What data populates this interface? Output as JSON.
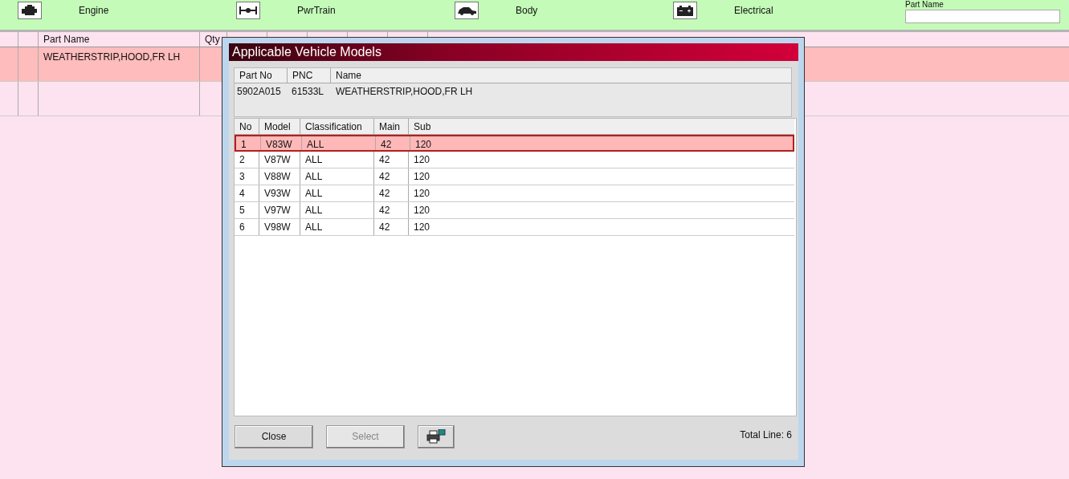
{
  "toolbar": {
    "categories": [
      {
        "kind": "engine",
        "label": "Engine"
      },
      {
        "kind": "drivetrain",
        "label": "PwrTrain"
      },
      {
        "kind": "car",
        "label": "Body"
      },
      {
        "kind": "battery",
        "label": "Electrical"
      }
    ],
    "search": {
      "label": "Part Name"
    }
  },
  "parts_table": {
    "columns": [
      "Part Name",
      "Qty"
    ],
    "rows": [
      {
        "selected": true,
        "part_name": "WEATHERSTRIP,HOOD,FR LH"
      },
      {
        "selected": false
      }
    ]
  },
  "dialog": {
    "title": "Applicable Vehicle Models",
    "part_info": {
      "columns": [
        "Part No",
        "PNC",
        "Name"
      ],
      "values": [
        "5902A015",
        "61533L",
        "WEATHERSTRIP,HOOD,FR LH"
      ]
    },
    "models": {
      "columns": [
        "No",
        "Model",
        "Classification",
        "Main",
        "Sub"
      ],
      "rows": [
        {
          "selected": true,
          "cells": [
            "1",
            "V83W",
            "ALL",
            "42",
            "120"
          ]
        },
        {
          "selected": false,
          "cells": [
            "2",
            "V87W",
            "ALL",
            "42",
            "120"
          ]
        },
        {
          "selected": false,
          "cells": [
            "3",
            "V88W",
            "ALL",
            "42",
            "120"
          ]
        },
        {
          "selected": false,
          "cells": [
            "4",
            "V93W",
            "ALL",
            "42",
            "120"
          ]
        },
        {
          "selected": false,
          "cells": [
            "5",
            "V97W",
            "ALL",
            "42",
            "120"
          ]
        },
        {
          "selected": false,
          "cells": [
            "6",
            "V98W",
            "ALL",
            "42",
            "120"
          ]
        }
      ]
    },
    "buttons": [
      {
        "label": "Close",
        "disabled": false
      },
      {
        "label": "Select",
        "disabled": true
      }
    ],
    "total": "Total Line: 6"
  }
}
